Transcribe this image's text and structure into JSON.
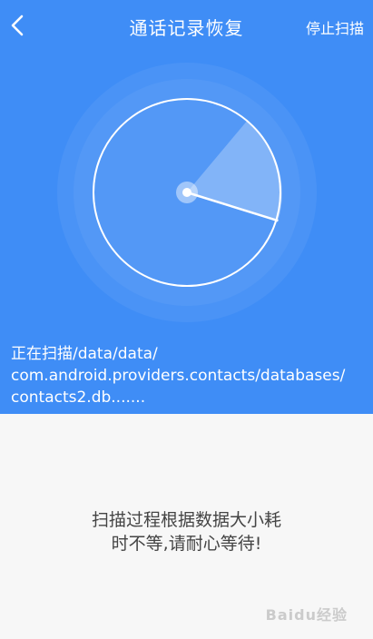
{
  "header": {
    "title": "通话记录恢复",
    "stop_label": "停止扫描",
    "back_icon": "back-arrow-icon"
  },
  "scan": {
    "line1": "正在扫描/data/data/",
    "line2": "com.android.providers.contacts/databases/",
    "line3": "contacts2.db......."
  },
  "notice": {
    "line1": "扫描过程根据数据大小耗",
    "line2": "时不等,请耐心等待!"
  },
  "watermark": {
    "text": "Baidu经验"
  },
  "colors": {
    "primary_blue": "#3f8df6",
    "background": "#f7f7f7",
    "text_dark": "#444444"
  }
}
